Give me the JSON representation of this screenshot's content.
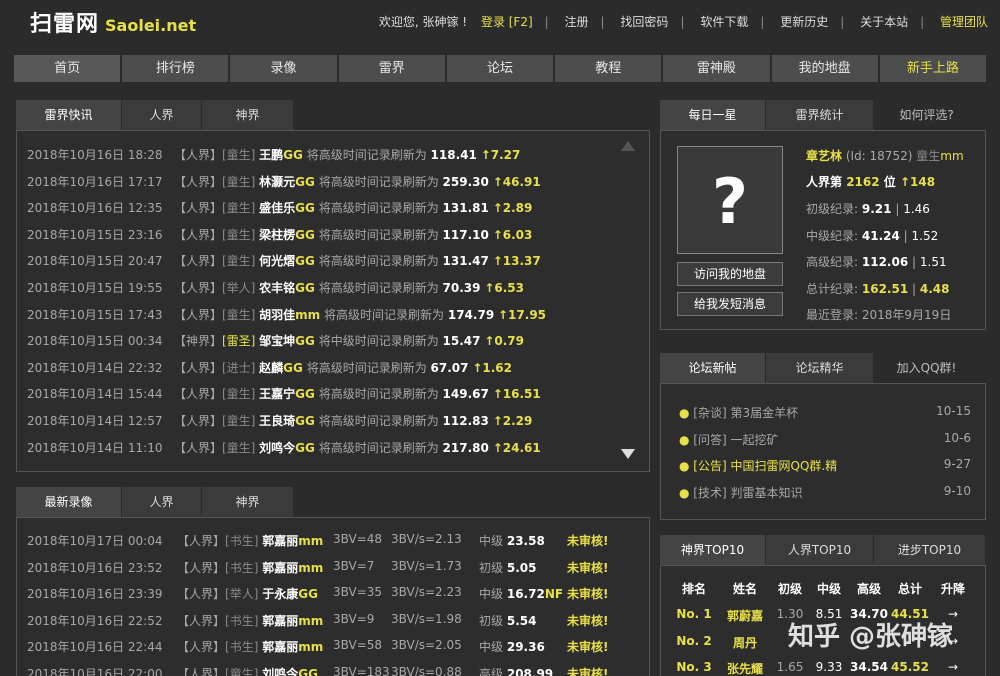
{
  "header": {
    "logo": "扫雷网",
    "logo_sub": "Saolei.net",
    "nav": [
      "欢迎您, 张砷镓 !",
      "登录 [F2]",
      "注册",
      "找回密码",
      "软件下载",
      "更新历史",
      "关于本站",
      "管理团队"
    ]
  },
  "mainnav": [
    "首页",
    "排行榜",
    "录像",
    "雷界",
    "论坛",
    "教程",
    "雷神殿",
    "我的地盘",
    "新手上路"
  ],
  "news": {
    "tabs": [
      "雷界快讯",
      "人界",
      "神界"
    ],
    "items": [
      {
        "time": "2018年10月16日 18:28",
        "realm": "【人界】",
        "title": "[童生]",
        "name": "王鹏",
        "suffix": "GG",
        "text": "将高级时间记录刷新为",
        "value": "118.41",
        "delta": "↑7.27"
      },
      {
        "time": "2018年10月16日 17:17",
        "realm": "【人界】",
        "title": "[童生]",
        "name": "林灏元",
        "suffix": "GG",
        "text": "将高级时间记录刷新为",
        "value": "259.30",
        "delta": "↑46.91"
      },
      {
        "time": "2018年10月16日 12:35",
        "realm": "【人界】",
        "title": "[童生]",
        "name": "盛佳乐",
        "suffix": "GG",
        "text": "将高级时间记录刷新为",
        "value": "131.81",
        "delta": "↑2.89"
      },
      {
        "time": "2018年10月15日 23:16",
        "realm": "【人界】",
        "title": "[童生]",
        "name": "梁柱楞",
        "suffix": "GG",
        "text": "将高级时间记录刷新为",
        "value": "117.10",
        "delta": "↑6.03"
      },
      {
        "time": "2018年10月15日 20:47",
        "realm": "【人界】",
        "title": "[童生]",
        "name": "何光熠",
        "suffix": "GG",
        "text": "将高级时间记录刷新为",
        "value": "131.47",
        "delta": "↑13.37"
      },
      {
        "time": "2018年10月15日 19:55",
        "realm": "【人界】",
        "title": "[举人]",
        "name": "农丰铭",
        "suffix": "GG",
        "text": "将高级时间记录刷新为",
        "value": "70.39",
        "delta": "↑6.53"
      },
      {
        "time": "2018年10月15日 17:43",
        "realm": "【人界】",
        "title": "[童生]",
        "name": "胡羽佳",
        "suffix": "mm",
        "text": "将高级时间记录刷新为",
        "value": "174.79",
        "delta": "↑17.95"
      },
      {
        "time": "2018年10月15日 00:34",
        "realm": "【神界】",
        "title": "[雷圣]",
        "name": "邹宝坤",
        "suffix": "GG",
        "text": "将中级时间记录刷新为",
        "value": "15.47",
        "delta": "↑0.79"
      },
      {
        "time": "2018年10月14日 22:32",
        "realm": "【人界】",
        "title": "[进士]",
        "name": "赵麟",
        "suffix": "GG",
        "text": "将高级时间记录刷新为",
        "value": "67.07",
        "delta": "↑1.62"
      },
      {
        "time": "2018年10月14日 15:44",
        "realm": "【人界】",
        "title": "[童生]",
        "name": "王嘉宁",
        "suffix": "GG",
        "text": "将高级时间记录刷新为",
        "value": "149.67",
        "delta": "↑16.51"
      },
      {
        "time": "2018年10月14日 12:57",
        "realm": "【人界】",
        "title": "[童生]",
        "name": "王良琦",
        "suffix": "GG",
        "text": "将高级时间记录刷新为",
        "value": "112.83",
        "delta": "↑2.29"
      },
      {
        "time": "2018年10月14日 11:10",
        "realm": "【人界】",
        "title": "[童生]",
        "name": "刘鸣今",
        "suffix": "GG",
        "text": "将高级时间记录刷新为",
        "value": "217.80",
        "delta": "↑24.61"
      }
    ]
  },
  "videos": {
    "tabs": [
      "最新录像",
      "人界",
      "神界"
    ],
    "items": [
      {
        "time": "2018年10月17日 00:04",
        "realm": "【人界】",
        "title": "[书生]",
        "name": "郭嘉丽",
        "suffix": "mm",
        "bv": "3BV=48",
        "bvs": "3BV/s=2.13",
        "level": "中级",
        "score": "23.58",
        "nf": "",
        "status": "未审核!"
      },
      {
        "time": "2018年10月16日 23:52",
        "realm": "【人界】",
        "title": "[书生]",
        "name": "郭嘉丽",
        "suffix": "mm",
        "bv": "3BV=7",
        "bvs": "3BV/s=1.73",
        "level": "初级",
        "score": "5.05",
        "nf": "",
        "status": "未审核!"
      },
      {
        "time": "2018年10月16日 23:39",
        "realm": "【人界】",
        "title": "[举人]",
        "name": "于永康",
        "suffix": "GG",
        "bv": "3BV=35",
        "bvs": "3BV/s=2.23",
        "level": "中级",
        "score": "16.72",
        "nf": "NF",
        "status": "未审核!"
      },
      {
        "time": "2018年10月16日 22:52",
        "realm": "【人界】",
        "title": "[书生]",
        "name": "郭嘉丽",
        "suffix": "mm",
        "bv": "3BV=9",
        "bvs": "3BV/s=1.98",
        "level": "初级",
        "score": "5.54",
        "nf": "",
        "status": "未审核!"
      },
      {
        "time": "2018年10月16日 22:44",
        "realm": "【人界】",
        "title": "[书生]",
        "name": "郭嘉丽",
        "suffix": "mm",
        "bv": "3BV=58",
        "bvs": "3BV/s=2.05",
        "level": "中级",
        "score": "29.36",
        "nf": "",
        "status": "未审核!"
      },
      {
        "time": "2018年10月16日 22:00",
        "realm": "【人界】",
        "title": "[童生]",
        "name": "刘鸣今",
        "suffix": "GG",
        "bv": "3BV=183",
        "bvs": "3BV/s=0.88",
        "level": "高级",
        "score": "208.99",
        "nf": "",
        "status": "未审核!"
      }
    ]
  },
  "star": {
    "tabs": [
      "每日一星",
      "雷界统计",
      "如何评选?"
    ],
    "avatar": "?",
    "name": "章艺林",
    "id": "(Id: 18752)",
    "title": "童生",
    "suffix": "mm",
    "rank_label": "人界第",
    "rank": "2162",
    "rank_unit": "位",
    "rank_delta": "↑148",
    "beg_label": "初级纪录:",
    "beg_time": "9.21",
    "beg_3bvs": "1.46",
    "int_label": "中级纪录:",
    "int_time": "41.24",
    "int_3bvs": "1.52",
    "exp_label": "高级纪录:",
    "exp_time": "112.06",
    "exp_3bvs": "1.51",
    "sum_label": "总计纪录:",
    "sum_time": "162.51",
    "sum_3bvs": "4.48",
    "last_label": "最近登录:",
    "last_date": "2018年9月19日",
    "btn_map": "访问我的地盘",
    "btn_msg": "给我发短消息"
  },
  "forum": {
    "tabs": [
      "论坛新帖",
      "论坛精华",
      "加入QQ群!"
    ],
    "items": [
      {
        "tag": "[杂谈]",
        "title": "第3届金羊杯",
        "date": "10-15",
        "hl": false
      },
      {
        "tag": "[问答]",
        "title": "一起挖矿",
        "date": "10-6",
        "hl": false
      },
      {
        "tag": "[公告]",
        "title": "中国扫雷网QQ群.精",
        "date": "9-27",
        "hl": true
      },
      {
        "tag": "[技术]",
        "title": "判雷基本知识",
        "date": "9-10",
        "hl": false
      }
    ]
  },
  "top10": {
    "tabs": [
      "神界TOP10",
      "人界TOP10",
      "进步TOP10"
    ],
    "headers": [
      "排名",
      "姓名",
      "初级",
      "中级",
      "高级",
      "总计",
      "升降"
    ],
    "rows": [
      {
        "rank": "No. 1",
        "name": "郭蔚嘉",
        "beg": "1.30",
        "int": "8.51",
        "exp": "34.70",
        "sum": "44.51",
        "move": "→"
      },
      {
        "rank": "No. 2",
        "name": "周丹",
        "beg": "",
        "int": "",
        "exp": "",
        "sum": "",
        "move": "→"
      },
      {
        "rank": "No. 3",
        "name": "张先耀",
        "beg": "1.65",
        "int": "9.33",
        "exp": "34.54",
        "sum": "45.52",
        "move": "→"
      }
    ]
  },
  "watermark": "知乎 @张砷镓"
}
